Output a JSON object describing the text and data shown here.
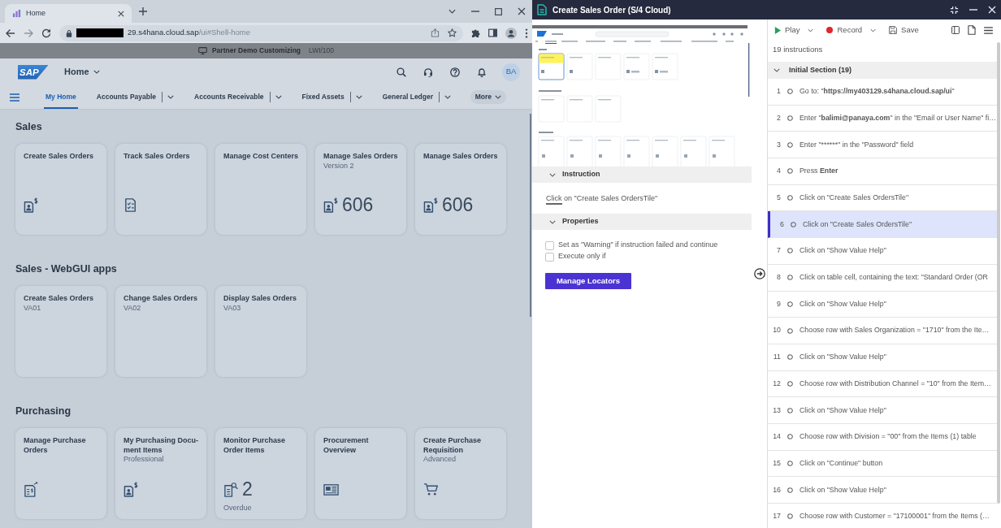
{
  "browser": {
    "tabs": [
      {
        "title": "Home",
        "selected": true
      }
    ],
    "address": {
      "host": "29.s4hana.cloud.sap",
      "path": "/ui#Shell-home"
    },
    "banner": {
      "system": "Partner Demo Customizing",
      "client": "LWI/100"
    }
  },
  "shell": {
    "logo": "SAP",
    "title": "Home",
    "avatar": "BA",
    "nav": [
      {
        "label": "My Home",
        "kind": "link",
        "selected": true
      },
      {
        "label": "Accounts Payable",
        "kind": "menu",
        "selected": false
      },
      {
        "label": "Accounts Receivable",
        "kind": "menu",
        "selected": false
      },
      {
        "label": "Fixed Assets",
        "kind": "menu",
        "selected": false
      },
      {
        "label": "General Ledger",
        "kind": "menu",
        "selected": false
      },
      {
        "label": "More",
        "kind": "overflow",
        "selected": false
      }
    ]
  },
  "groups": [
    {
      "title": "Sales",
      "tiles": [
        {
          "title": "Create Sales Orders"
        },
        {
          "title": "Track Sales Orders"
        },
        {
          "title": "Manage Cost Centers"
        },
        {
          "title": "Manage Sales Orders",
          "subtitle": "Version 2",
          "number": "606"
        },
        {
          "title": "Manage Sales Orders",
          "number": "606"
        }
      ]
    },
    {
      "title": "Sales - WebGUI apps",
      "tiles": [
        {
          "title": "Create Sales Orders",
          "subtitle": "VA01"
        },
        {
          "title": "Change Sales Orders",
          "subtitle": "VA02"
        },
        {
          "title": "Display Sales Orders",
          "subtitle": "VA03"
        }
      ]
    },
    {
      "title": "Purchasing",
      "tiles": [
        {
          "title": "Manage Purchase\nOrders"
        },
        {
          "title": "My Purchasing Docu-\nment Items",
          "subtitle": "Professional"
        },
        {
          "title": "Monitor Purchase\nOrder Items",
          "number": "2",
          "footer": "Overdue"
        },
        {
          "title": "Procurement\nOverview"
        },
        {
          "title": "Create Purchase\nRequisition",
          "subtitle": "Advanced"
        }
      ]
    }
  ],
  "recorder": {
    "title": "Create Sales Order (S/4 Cloud)",
    "instruction": {
      "heading": "Instruction",
      "expanded": true,
      "verb": "Click",
      "target": "on \"Create Sales OrdersTile\""
    },
    "properties": {
      "heading": "Properties",
      "expanded": true,
      "options": [
        {
          "label": "Set as \"Warning\" if instruction failed and continue",
          "checked": false
        },
        {
          "label": "Execute only if",
          "checked": false
        }
      ],
      "button": "Manage Locators"
    },
    "toolbar": {
      "play": "Play",
      "record": "Record",
      "save": "Save"
    },
    "count": "19 instructions",
    "section": {
      "title": "Initial Section (19)",
      "expanded": true
    },
    "steps": [
      {
        "number": "1",
        "selected": false,
        "runs": [
          {
            "text": "Go to: \"",
            "bold": false
          },
          {
            "text": "https://my403129.s4hana.cloud.sap/ui",
            "bold": true
          },
          {
            "text": "\"",
            "bold": false
          }
        ]
      },
      {
        "number": "2",
        "selected": false,
        "runs": [
          {
            "text": "Enter \"",
            "bold": false
          },
          {
            "text": "balimi@panaya.com",
            "bold": true
          },
          {
            "text": "\" in the \"Email or User Name\" fi…",
            "bold": false
          }
        ]
      },
      {
        "number": "3",
        "selected": false,
        "runs": [
          {
            "text": "Enter \"******\" in the \"Password\" field",
            "bold": false
          }
        ]
      },
      {
        "number": "4",
        "selected": false,
        "runs": [
          {
            "text": "Press ",
            "bold": false
          },
          {
            "text": "Enter",
            "bold": true
          }
        ]
      },
      {
        "number": "5",
        "selected": false,
        "runs": [
          {
            "text": "Click on \"Create Sales OrdersTile\"",
            "bold": false
          }
        ]
      },
      {
        "number": "6",
        "selected": true,
        "runs": [
          {
            "text": "Click on \"Create Sales OrdersTile\"",
            "bold": false
          }
        ]
      },
      {
        "number": "7",
        "selected": false,
        "runs": [
          {
            "text": "Click on \"Show Value Help\"",
            "bold": false
          }
        ]
      },
      {
        "number": "8",
        "selected": false,
        "runs": [
          {
            "text": "Click on table cell, containing the text: \"Standard Order (OR",
            "bold": false
          }
        ]
      },
      {
        "number": "9",
        "selected": false,
        "runs": [
          {
            "text": "Click on \"Show Value Help\"",
            "bold": false
          }
        ]
      },
      {
        "number": "10",
        "selected": false,
        "runs": [
          {
            "text": "Choose row with Sales Organization = \"1710\" from the Ite…",
            "bold": false
          }
        ]
      },
      {
        "number": "11",
        "selected": false,
        "runs": [
          {
            "text": "Click on \"Show Value Help\"",
            "bold": false
          }
        ]
      },
      {
        "number": "12",
        "selected": false,
        "runs": [
          {
            "text": "Choose row with Distribution Channel = \"10\" from the Item…",
            "bold": false
          }
        ]
      },
      {
        "number": "13",
        "selected": false,
        "runs": [
          {
            "text": "Click on \"Show Value Help\"",
            "bold": false
          }
        ]
      },
      {
        "number": "14",
        "selected": false,
        "runs": [
          {
            "text": "Choose row with Division = \"00\" from the Items (1) table",
            "bold": false
          }
        ]
      },
      {
        "number": "15",
        "selected": false,
        "runs": [
          {
            "text": "Click on \"Continue\" button",
            "bold": false
          }
        ]
      },
      {
        "number": "16",
        "selected": false,
        "runs": [
          {
            "text": "Click on \"Show Value Help\"",
            "bold": false
          }
        ]
      },
      {
        "number": "17",
        "selected": false,
        "runs": [
          {
            "text": "Choose row with Customer = \"17100001\" from the Items (…",
            "bold": false
          }
        ]
      }
    ]
  }
}
